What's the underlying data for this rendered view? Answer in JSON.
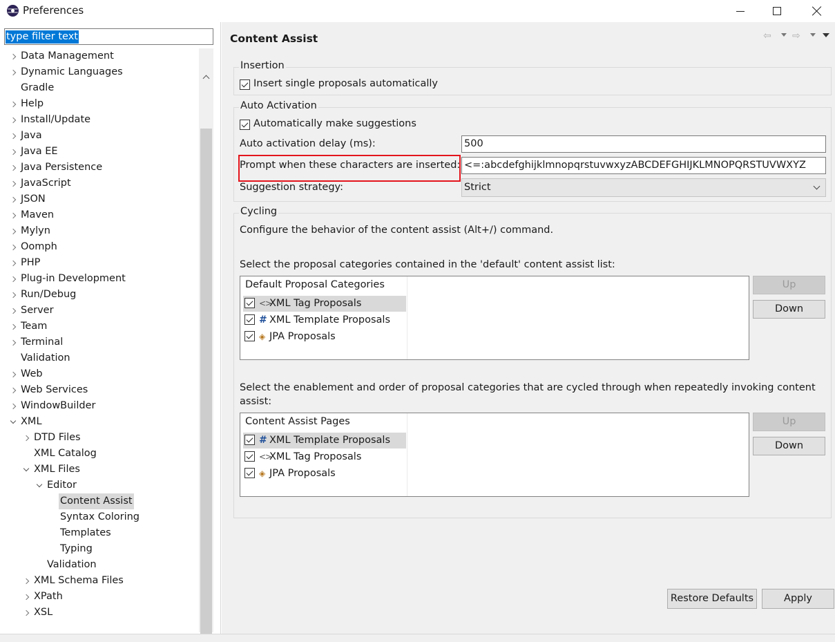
{
  "window": {
    "title": "Preferences"
  },
  "filter": {
    "placeholder": "type filter text"
  },
  "tree": {
    "items": [
      {
        "label": "Data Management",
        "level": 0,
        "expander": "collapsed"
      },
      {
        "label": "Dynamic Languages",
        "level": 0,
        "expander": "collapsed"
      },
      {
        "label": "Gradle",
        "level": 0,
        "expander": "none"
      },
      {
        "label": "Help",
        "level": 0,
        "expander": "collapsed"
      },
      {
        "label": "Install/Update",
        "level": 0,
        "expander": "collapsed"
      },
      {
        "label": "Java",
        "level": 0,
        "expander": "collapsed"
      },
      {
        "label": "Java EE",
        "level": 0,
        "expander": "collapsed"
      },
      {
        "label": "Java Persistence",
        "level": 0,
        "expander": "collapsed"
      },
      {
        "label": "JavaScript",
        "level": 0,
        "expander": "collapsed"
      },
      {
        "label": "JSON",
        "level": 0,
        "expander": "collapsed"
      },
      {
        "label": "Maven",
        "level": 0,
        "expander": "collapsed"
      },
      {
        "label": "Mylyn",
        "level": 0,
        "expander": "collapsed"
      },
      {
        "label": "Oomph",
        "level": 0,
        "expander": "collapsed"
      },
      {
        "label": "PHP",
        "level": 0,
        "expander": "collapsed"
      },
      {
        "label": "Plug-in Development",
        "level": 0,
        "expander": "collapsed"
      },
      {
        "label": "Run/Debug",
        "level": 0,
        "expander": "collapsed"
      },
      {
        "label": "Server",
        "level": 0,
        "expander": "collapsed"
      },
      {
        "label": "Team",
        "level": 0,
        "expander": "collapsed"
      },
      {
        "label": "Terminal",
        "level": 0,
        "expander": "collapsed"
      },
      {
        "label": "Validation",
        "level": 0,
        "expander": "none"
      },
      {
        "label": "Web",
        "level": 0,
        "expander": "collapsed"
      },
      {
        "label": "Web Services",
        "level": 0,
        "expander": "collapsed"
      },
      {
        "label": "WindowBuilder",
        "level": 0,
        "expander": "collapsed"
      },
      {
        "label": "XML",
        "level": 0,
        "expander": "expanded"
      },
      {
        "label": "DTD Files",
        "level": 1,
        "expander": "collapsed"
      },
      {
        "label": "XML Catalog",
        "level": 1,
        "expander": "none"
      },
      {
        "label": "XML Files",
        "level": 1,
        "expander": "expanded"
      },
      {
        "label": "Editor",
        "level": 2,
        "expander": "expanded"
      },
      {
        "label": "Content Assist",
        "level": 3,
        "expander": "none",
        "selected": true
      },
      {
        "label": "Syntax Coloring",
        "level": 3,
        "expander": "none"
      },
      {
        "label": "Templates",
        "level": 3,
        "expander": "none"
      },
      {
        "label": "Typing",
        "level": 3,
        "expander": "none"
      },
      {
        "label": "Validation",
        "level": 2,
        "expander": "none"
      },
      {
        "label": "XML Schema Files",
        "level": 1,
        "expander": "collapsed"
      },
      {
        "label": "XPath",
        "level": 1,
        "expander": "collapsed"
      },
      {
        "label": "XSL",
        "level": 1,
        "expander": "collapsed"
      }
    ]
  },
  "page": {
    "title": "Content Assist",
    "nav_back_glyph": "⇦",
    "nav_forward_glyph": "⇨"
  },
  "insertion": {
    "legend": "Insertion",
    "insert_single_label": "Insert single proposals automatically",
    "insert_single_checked": true
  },
  "auto_activation": {
    "legend": "Auto Activation",
    "auto_suggest_label": "Automatically make suggestions",
    "auto_suggest_checked": true,
    "delay_label": "Auto activation delay (ms):",
    "delay_value": "500",
    "prompt_label": "Prompt when these characters are inserted:",
    "prompt_value": "<=:abcdefghijklmnopqrstuvwxyzABCDEFGHIJKLMNOPQRSTUVWXYZ",
    "strategy_label": "Suggestion strategy:",
    "strategy_value": "Strict"
  },
  "cycling": {
    "legend": "Cycling",
    "description": "Configure the behavior of the content assist (Alt+/) command.",
    "default_list_label": "Select the proposal categories contained in the 'default' content assist list:",
    "default_list": {
      "header": "Default Proposal Categories",
      "rows": [
        {
          "icon": "xml-tag-icon",
          "glyph": "<>",
          "label": "XML Tag Proposals",
          "checked": true,
          "highlighted": true
        },
        {
          "icon": "template-hash-icon",
          "glyph": "#",
          "label": "XML Template Proposals",
          "checked": true,
          "highlighted": false
        },
        {
          "icon": "jpa-icon",
          "glyph": "◈",
          "label": "JPA Proposals",
          "checked": true,
          "highlighted": false
        }
      ],
      "up_label": "Up",
      "down_label": "Down"
    },
    "cycle_list_label_line1": "Select the enablement and order of proposal categories that are cycled through when repeatedly invoking content",
    "cycle_list_label_line2": "assist:",
    "cycle_list": {
      "header": "Content Assist Pages",
      "rows": [
        {
          "icon": "template-hash-icon",
          "glyph": "#",
          "label": "XML Template Proposals",
          "checked": true,
          "highlighted": true
        },
        {
          "icon": "xml-tag-icon",
          "glyph": "<>",
          "label": "XML Tag Proposals",
          "checked": true,
          "highlighted": false
        },
        {
          "icon": "jpa-icon",
          "glyph": "◈",
          "label": "JPA Proposals",
          "checked": true,
          "highlighted": false
        }
      ],
      "up_label": "Up",
      "down_label": "Down"
    }
  },
  "buttons": {
    "restore_defaults": "Restore Defaults",
    "apply": "Apply"
  },
  "colors": {
    "accent_selection": "#0078d7",
    "highlight_box": "#e3141b",
    "tree_selected": "#d9d9d9"
  }
}
